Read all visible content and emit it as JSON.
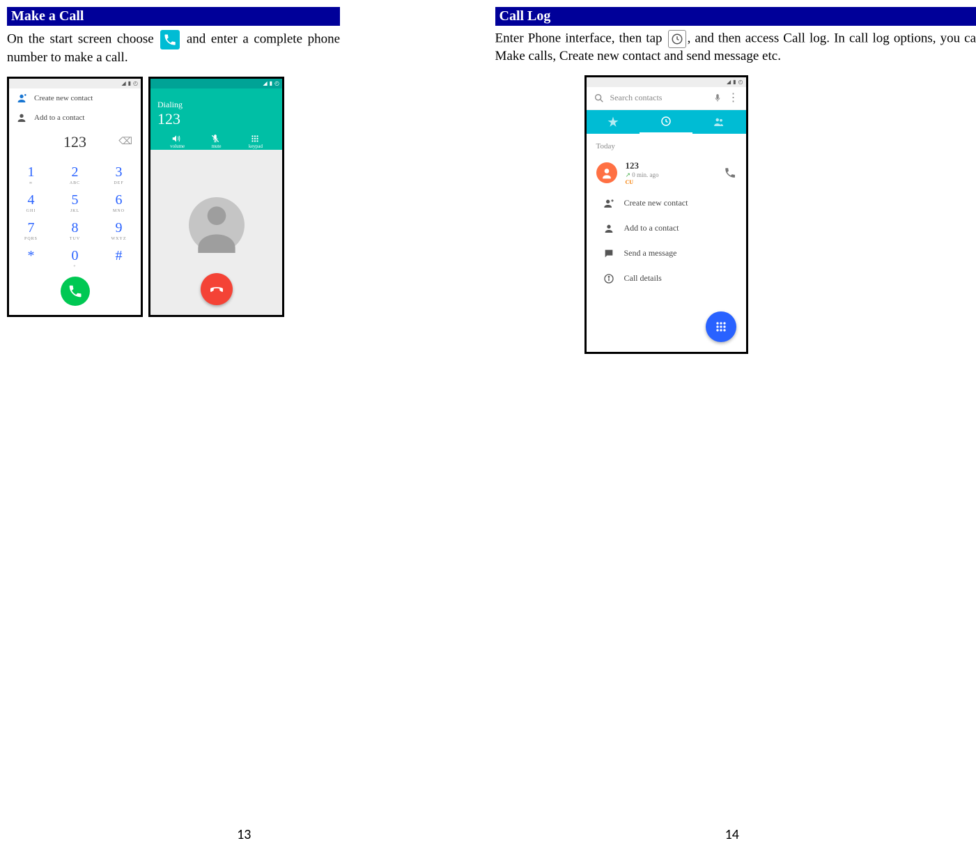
{
  "page_left": {
    "header": "Make a Call",
    "body_before": "On the start screen choose",
    "body_after": "and enter a complete phone number to make a call.",
    "page_number": "13"
  },
  "page_right": {
    "header": "Call Log",
    "body_before": "Enter Phone interface, then tap",
    "body_after": ", and then access Call log. In call log options, you can Make calls, Create new contact and send message etc.",
    "page_number": "14"
  },
  "dialer_screen": {
    "create_contact": "Create new contact",
    "add_contact": "Add to a contact",
    "typed_number": "123",
    "keys": [
      {
        "d": "1",
        "l": "∞"
      },
      {
        "d": "2",
        "l": "ABC"
      },
      {
        "d": "3",
        "l": "DEF"
      },
      {
        "d": "4",
        "l": "GHI"
      },
      {
        "d": "5",
        "l": "JKL"
      },
      {
        "d": "6",
        "l": "MNO"
      },
      {
        "d": "7",
        "l": "PQRS"
      },
      {
        "d": "8",
        "l": "TUV"
      },
      {
        "d": "9",
        "l": "WXYZ"
      },
      {
        "d": "*",
        "l": ""
      },
      {
        "d": "0",
        "l": "+"
      },
      {
        "d": "#",
        "l": ""
      }
    ]
  },
  "dialing_screen": {
    "label": "Dialing",
    "number": "123",
    "btn_volume": "volume",
    "btn_mute": "mute",
    "btn_keypad": "keypad"
  },
  "calllog_screen": {
    "search_placeholder": "Search contacts",
    "today": "Today",
    "entry_number": "123",
    "entry_time": "0 min. ago",
    "entry_carrier": "CU",
    "action_create": "Create new contact",
    "action_add": "Add to a contact",
    "action_message": "Send a message",
    "action_details": "Call details"
  }
}
